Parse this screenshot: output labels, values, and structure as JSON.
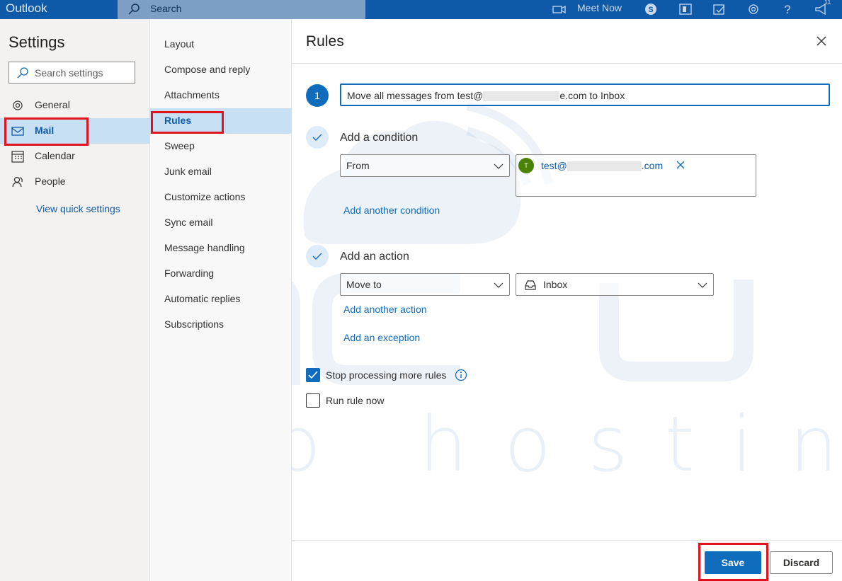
{
  "topbar": {
    "brand": "Outlook",
    "search_placeholder": "Search",
    "meet_now": "Meet Now",
    "notification_count": "11"
  },
  "settings": {
    "title": "Settings",
    "search_placeholder": "Search settings",
    "nav": [
      {
        "label": "General",
        "icon": "gear-icon"
      },
      {
        "label": "Mail",
        "icon": "mail-icon",
        "selected": true
      },
      {
        "label": "Calendar",
        "icon": "calendar-icon"
      },
      {
        "label": "People",
        "icon": "people-icon"
      }
    ],
    "view_quick_settings": "View quick settings"
  },
  "mail_settings": {
    "items": [
      "Layout",
      "Compose and reply",
      "Attachments",
      "Rules",
      "Sweep",
      "Junk email",
      "Customize actions",
      "Sync email",
      "Message handling",
      "Forwarding",
      "Automatic replies",
      "Subscriptions"
    ],
    "selected": "Rules"
  },
  "rules": {
    "title": "Rules",
    "step_number": "1",
    "rule_name_prefix": "Move all messages from test@",
    "rule_name_suffix": "e.com to Inbox",
    "condition": {
      "title": "Add a condition",
      "field": "From",
      "recipient_initial": "T",
      "recipient_prefix": "test@",
      "recipient_suffix": ".com",
      "add_link": "Add another condition"
    },
    "action": {
      "title": "Add an action",
      "field": "Move to",
      "folder": "Inbox",
      "add_link": "Add another action",
      "exception_link": "Add an exception"
    },
    "options": {
      "stop_processing": "Stop processing more rules",
      "stop_processing_checked": true,
      "run_now": "Run rule now",
      "run_now_checked": false
    },
    "save": "Save",
    "discard": "Discard"
  },
  "watermark": "web hosting",
  "colors": {
    "accent": "#0f6cbd",
    "topbar": "#0f5aa8",
    "highlight": "#e0141e",
    "selection": "#c7e0f4"
  }
}
